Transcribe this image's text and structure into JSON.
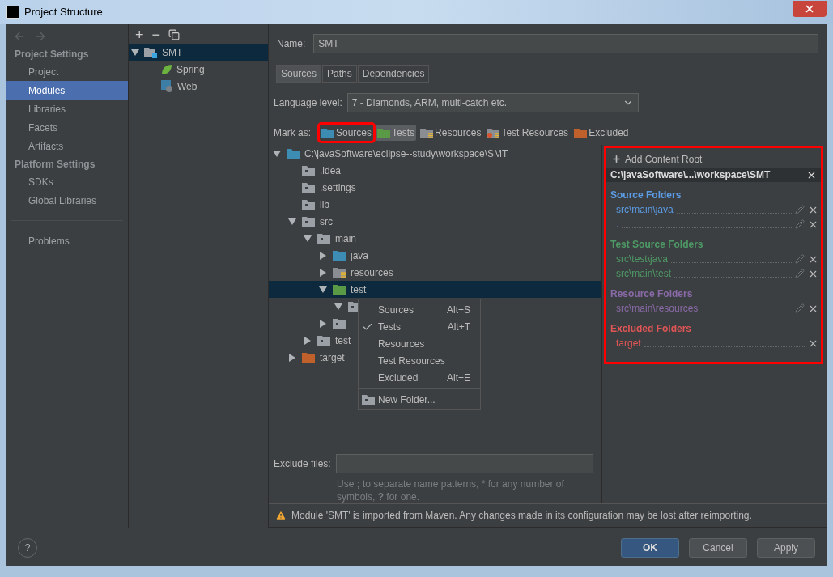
{
  "window": {
    "title": "Project Structure"
  },
  "nav": {
    "sections": [
      {
        "heading": "Project Settings",
        "items": [
          {
            "label": "Project",
            "selected": false
          },
          {
            "label": "Modules",
            "selected": true
          },
          {
            "label": "Libraries",
            "selected": false
          },
          {
            "label": "Facets",
            "selected": false
          },
          {
            "label": "Artifacts",
            "selected": false
          }
        ]
      },
      {
        "heading": "Platform Settings",
        "items": [
          {
            "label": "SDKs",
            "selected": false
          },
          {
            "label": "Global Libraries",
            "selected": false
          }
        ]
      }
    ],
    "extra_items": [
      {
        "label": "Problems",
        "selected": false
      }
    ]
  },
  "modules": {
    "toolbar": [
      "+",
      "−"
    ],
    "tree": [
      {
        "name": "SMT",
        "kind": "module",
        "expanded": true,
        "selected": true,
        "children": [
          {
            "name": "Spring",
            "kind": "spring",
            "selected": false
          },
          {
            "name": "Web",
            "kind": "web",
            "selected": false
          }
        ]
      }
    ]
  },
  "name_field": {
    "label": "Name:",
    "value": "SMT"
  },
  "tabs": [
    {
      "label": "Sources",
      "selected": true
    },
    {
      "label": "Paths",
      "selected": false
    },
    {
      "label": "Dependencies",
      "selected": false
    }
  ],
  "language_level": {
    "label": "Language level:",
    "value": "7 - Diamonds, ARM, multi-catch etc."
  },
  "mark_as": {
    "label": "Mark as:",
    "options": [
      {
        "label": "Sources",
        "kind": "sources",
        "selected": false
      },
      {
        "label": "Tests",
        "kind": "tests",
        "selected": true
      },
      {
        "label": "Resources",
        "kind": "resources",
        "selected": false
      },
      {
        "label": "Test Resources",
        "kind": "test_resources",
        "selected": false
      },
      {
        "label": "Excluded",
        "kind": "excluded",
        "selected": false
      }
    ]
  },
  "folder_tree": [
    {
      "name": "C:\\javaSoftware\\eclipse--study\\workspace\\SMT",
      "kind": "sources",
      "expanded": true,
      "selected": false,
      "children": [
        {
          "name": ".idea",
          "kind": "plain",
          "selected": false
        },
        {
          "name": ".settings",
          "kind": "plain",
          "selected": false
        },
        {
          "name": "lib",
          "kind": "plain",
          "selected": false
        },
        {
          "name": "src",
          "kind": "plain",
          "expanded": true,
          "selected": false,
          "children": [
            {
              "name": "main",
              "kind": "plain",
              "expanded": true,
              "selected": false,
              "children": [
                {
                  "name": "java",
                  "kind": "sources",
                  "expanded": false,
                  "selected": false
                },
                {
                  "name": "resources",
                  "kind": "resources",
                  "expanded": false,
                  "selected": false
                },
                {
                  "name": "test",
                  "kind": "tests",
                  "expanded": true,
                  "selected": true,
                  "children": [
                    {
                      "kind": "plain",
                      "expanded": true,
                      "selected": false
                    }
                  ]
                },
                {
                  "kind": "plain",
                  "expanded": false,
                  "selected": false
                }
              ]
            },
            {
              "name": "test",
              "kind": "plain",
              "expanded": false,
              "selected": false
            }
          ]
        },
        {
          "name": "target",
          "kind": "excluded",
          "expanded": false,
          "selected": false
        }
      ]
    }
  ],
  "context_menu": {
    "items": [
      {
        "label": "Sources",
        "shortcut": "Alt+S",
        "checked": false,
        "kind": "mark"
      },
      {
        "label": "Tests",
        "shortcut": "Alt+T",
        "checked": true,
        "kind": "mark"
      },
      {
        "label": "Resources",
        "checked": false,
        "kind": "mark"
      },
      {
        "label": "Test Resources",
        "checked": false,
        "kind": "mark"
      },
      {
        "label": "Excluded",
        "shortcut": "Alt+E",
        "checked": false,
        "kind": "mark"
      },
      {
        "label": "New Folder...",
        "kind": "new_folder"
      }
    ]
  },
  "exclude_files": {
    "label": "Exclude files:",
    "hint": "Use **;** to separate name patterns, * for any number of symbols, **?** for one."
  },
  "content_roots": {
    "add_label": "Add Content Root",
    "root": "C:\\javaSoftware\\...\\workspace\\SMT",
    "groups": [
      {
        "title": "Source Folders",
        "color": "#5c9ce6",
        "entries": [
          {
            "path": "src\\main\\java",
            "editable": true
          },
          {
            "path": ".",
            "editable": true
          }
        ]
      },
      {
        "title": "Test Source Folders",
        "color": "#4e9a66",
        "entries": [
          {
            "path": "src\\test\\java",
            "editable": true
          },
          {
            "path": "src\\main\\test",
            "editable": true
          }
        ]
      },
      {
        "title": "Resource Folders",
        "color": "#8a6aa8",
        "entries": [
          {
            "path": "src\\main\\resources",
            "editable": true
          }
        ]
      },
      {
        "title": "Excluded Folders",
        "color": "#e05555",
        "entries": [
          {
            "path": "target",
            "editable": false
          }
        ]
      }
    ]
  },
  "warning": "Module 'SMT' is imported from Maven. Any changes made in its configuration may be lost after reimporting.",
  "help": "?",
  "buttons": [
    {
      "label": "OK",
      "kind": "primary"
    },
    {
      "label": "Cancel",
      "kind": "secondary"
    },
    {
      "label": "Apply",
      "kind": "secondary"
    }
  ]
}
